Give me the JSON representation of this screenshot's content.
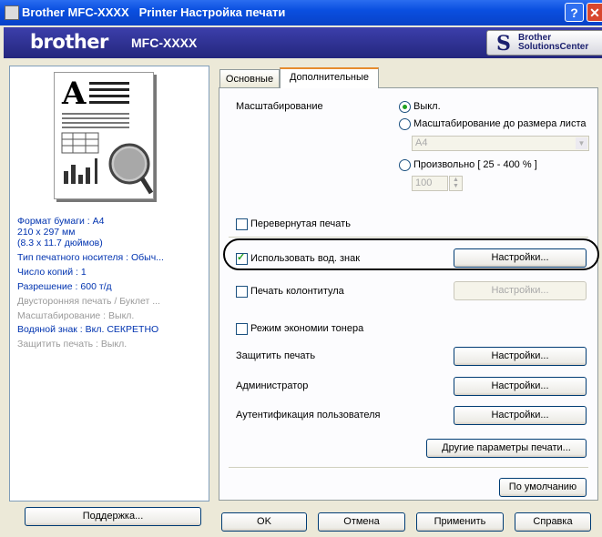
{
  "window": {
    "title": "Brother MFC-XXXX   Printer Настройка печати"
  },
  "brand": {
    "logo": "brother",
    "model": "MFC-XXXX",
    "solutions_center": {
      "icon": "S",
      "line1": "Brother",
      "line2": "SolutionsCenter"
    }
  },
  "summary": [
    {
      "text": "Формат бумаги : A4",
      "style": "blue"
    },
    {
      "text": "210 x 297 мм",
      "style": "blue"
    },
    {
      "text": "(8.3 x 11.7 дюймов)",
      "style": "blue"
    },
    {
      "text": "Тип печатного носителя : Обыч...",
      "style": "blue"
    },
    {
      "text": "Число копий : 1",
      "style": "blue"
    },
    {
      "text": "Разрешение : 600 т/д",
      "style": "blue"
    },
    {
      "text": "Двусторонняя печать / Буклет ...",
      "style": "gray"
    },
    {
      "text": "Масштабирование : Выкл.",
      "style": "gray"
    },
    {
      "text": "Водяной знак : Вкл. СЕКРЕТНО",
      "style": "blue"
    },
    {
      "text": "Защитить печать : Выкл.",
      "style": "gray"
    }
  ],
  "support_button": "Поддержка...",
  "tabs": [
    {
      "label": "Основные"
    },
    {
      "label": "Дополнительные"
    }
  ],
  "scaling": {
    "label": "Масштабирование",
    "off": "Выкл.",
    "fit_page": "Масштабирование до размера листа",
    "paper_value": "A4",
    "free": "Произвольно [ 25 - 400 % ]",
    "free_value": "100"
  },
  "mirror_print": "Перевернутая печать",
  "watermark": {
    "label": "Использовать вод. знак",
    "button": "Настройки..."
  },
  "header_footer": {
    "label": "Печать колонтитула",
    "button": "Настройки..."
  },
  "toner_save": "Режим экономии тонера",
  "secure_print": {
    "label": "Защитить печать",
    "button": "Настройки..."
  },
  "administrator": {
    "label": "Администратор",
    "button": "Настройки..."
  },
  "user_auth": {
    "label": "Аутентификация пользователя",
    "button": "Настройки..."
  },
  "other_print_options": "Другие параметры печати...",
  "default_button": "По умолчанию",
  "footer": {
    "ok": "OK",
    "cancel": "Отмена",
    "apply": "Применить",
    "help": "Справка"
  }
}
